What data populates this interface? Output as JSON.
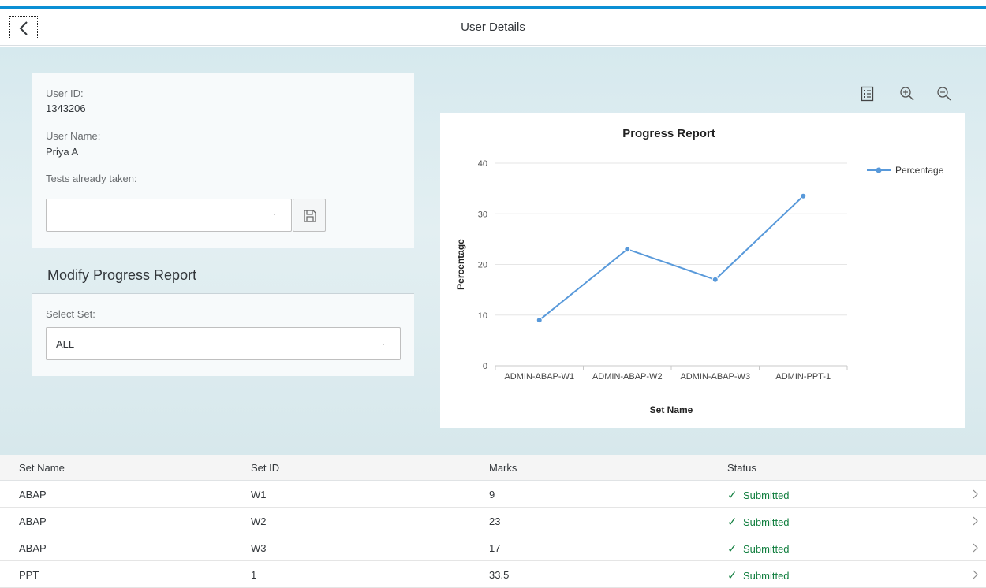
{
  "header": {
    "title": "User Details",
    "back_icon": "chevron-left-icon"
  },
  "user": {
    "id_label": "User ID:",
    "id_value": "1343206",
    "name_label": "User Name:",
    "name_value": "Priya A",
    "tests_label": "Tests already taken:",
    "tests_value": "",
    "save_icon": "save-icon"
  },
  "modify": {
    "title": "Modify Progress Report",
    "select_label": "Select Set:",
    "selected_set": "ALL"
  },
  "toolbar": {
    "legend_icon": "legend-icon",
    "zoom_in_icon": "zoom-in-icon",
    "zoom_out_icon": "zoom-out-icon"
  },
  "chart_data": {
    "type": "line",
    "title": "Progress Report",
    "xlabel": "Set Name",
    "ylabel": "Percentage",
    "categories": [
      "ADMIN-ABAP-W1",
      "ADMIN-ABAP-W2",
      "ADMIN-ABAP-W3",
      "ADMIN-PPT-1"
    ],
    "series": [
      {
        "name": "Percentage",
        "values": [
          9,
          23,
          17,
          33.5
        ],
        "color": "#5899da"
      }
    ],
    "ylim": [
      0,
      40
    ],
    "yticks": [
      0,
      10,
      20,
      30,
      40
    ],
    "grid": true,
    "legend_position": "right"
  },
  "table": {
    "columns": [
      "Set Name",
      "Set ID",
      "Marks",
      "Status"
    ],
    "rows": [
      {
        "set_name": "ABAP",
        "set_id": "W1",
        "marks": "9",
        "status": "Submitted"
      },
      {
        "set_name": "ABAP",
        "set_id": "W2",
        "marks": "23",
        "status": "Submitted"
      },
      {
        "set_name": "ABAP",
        "set_id": "W3",
        "marks": "17",
        "status": "Submitted"
      },
      {
        "set_name": "PPT",
        "set_id": "1",
        "marks": "33.5",
        "status": "Submitted"
      }
    ],
    "status_color": "#107e3e"
  }
}
